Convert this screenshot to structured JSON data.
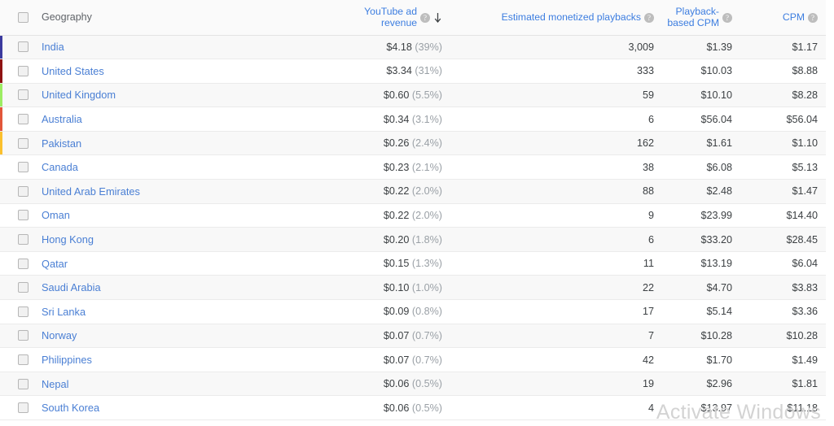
{
  "table": {
    "columns": [
      {
        "key": "geography",
        "label": "Geography",
        "icon": "",
        "align": "left"
      },
      {
        "key": "revenue",
        "label": "YouTube ad revenue",
        "icon": "help-icon",
        "sort": "descending",
        "align": "right"
      },
      {
        "key": "playbacks",
        "label": "Estimated monetized playbacks",
        "icon": "help-icon",
        "align": "right"
      },
      {
        "key": "pb_cpm",
        "label": "Playback-based CPM",
        "icon": "help-icon",
        "align": "right"
      },
      {
        "key": "cpm",
        "label": "CPM",
        "icon": "help-icon",
        "align": "right"
      }
    ],
    "header_checkbox": "unchecked",
    "sort_icon": "arrow-down-icon",
    "rows": [
      {
        "geography": "India",
        "revenue": "$4.18",
        "percent": "(39%)",
        "playbacks": "3,009",
        "pb_cpm": "$1.39",
        "cpm": "$1.17",
        "color": "#3b3a9e"
      },
      {
        "geography": "United States",
        "revenue": "$3.34",
        "percent": "(31%)",
        "playbacks": "333",
        "pb_cpm": "$10.03",
        "cpm": "$8.88",
        "color": "#8f1313"
      },
      {
        "geography": "United Kingdom",
        "revenue": "$0.60",
        "percent": "(5.5%)",
        "playbacks": "59",
        "pb_cpm": "$10.10",
        "cpm": "$8.28",
        "color": "#9ced63"
      },
      {
        "geography": "Australia",
        "revenue": "$0.34",
        "percent": "(3.1%)",
        "playbacks": "6",
        "pb_cpm": "$56.04",
        "cpm": "$56.04",
        "color": "#e2563a"
      },
      {
        "geography": "Pakistan",
        "revenue": "$0.26",
        "percent": "(2.4%)",
        "playbacks": "162",
        "pb_cpm": "$1.61",
        "cpm": "$1.10",
        "color": "#fbc02d"
      },
      {
        "geography": "Canada",
        "revenue": "$0.23",
        "percent": "(2.1%)",
        "playbacks": "38",
        "pb_cpm": "$6.08",
        "cpm": "$5.13",
        "color": ""
      },
      {
        "geography": "United Arab Emirates",
        "revenue": "$0.22",
        "percent": "(2.0%)",
        "playbacks": "88",
        "pb_cpm": "$2.48",
        "cpm": "$1.47",
        "color": ""
      },
      {
        "geography": "Oman",
        "revenue": "$0.22",
        "percent": "(2.0%)",
        "playbacks": "9",
        "pb_cpm": "$23.99",
        "cpm": "$14.40",
        "color": ""
      },
      {
        "geography": "Hong Kong",
        "revenue": "$0.20",
        "percent": "(1.8%)",
        "playbacks": "6",
        "pb_cpm": "$33.20",
        "cpm": "$28.45",
        "color": ""
      },
      {
        "geography": "Qatar",
        "revenue": "$0.15",
        "percent": "(1.3%)",
        "playbacks": "11",
        "pb_cpm": "$13.19",
        "cpm": "$6.04",
        "color": ""
      },
      {
        "geography": "Saudi Arabia",
        "revenue": "$0.10",
        "percent": "(1.0%)",
        "playbacks": "22",
        "pb_cpm": "$4.70",
        "cpm": "$3.83",
        "color": ""
      },
      {
        "geography": "Sri Lanka",
        "revenue": "$0.09",
        "percent": "(0.8%)",
        "playbacks": "17",
        "pb_cpm": "$5.14",
        "cpm": "$3.36",
        "color": ""
      },
      {
        "geography": "Norway",
        "revenue": "$0.07",
        "percent": "(0.7%)",
        "playbacks": "7",
        "pb_cpm": "$10.28",
        "cpm": "$10.28",
        "color": ""
      },
      {
        "geography": "Philippines",
        "revenue": "$0.07",
        "percent": "(0.7%)",
        "playbacks": "42",
        "pb_cpm": "$1.70",
        "cpm": "$1.49",
        "color": ""
      },
      {
        "geography": "Nepal",
        "revenue": "$0.06",
        "percent": "(0.5%)",
        "playbacks": "19",
        "pb_cpm": "$2.96",
        "cpm": "$1.81",
        "color": ""
      },
      {
        "geography": "South Korea",
        "revenue": "$0.06",
        "percent": "(0.5%)",
        "playbacks": "4",
        "pb_cpm": "$13.97",
        "cpm": "$11.18",
        "color": ""
      }
    ]
  },
  "watermark": {
    "text": "Activate Windows"
  },
  "theme": {
    "link_color": "#4a7fd4",
    "header_metric_color": "#3c7de0",
    "muted_color": "#9aa0a6",
    "row_alt_bg": "#f8f8f8",
    "header_bg": "#fafafa"
  }
}
